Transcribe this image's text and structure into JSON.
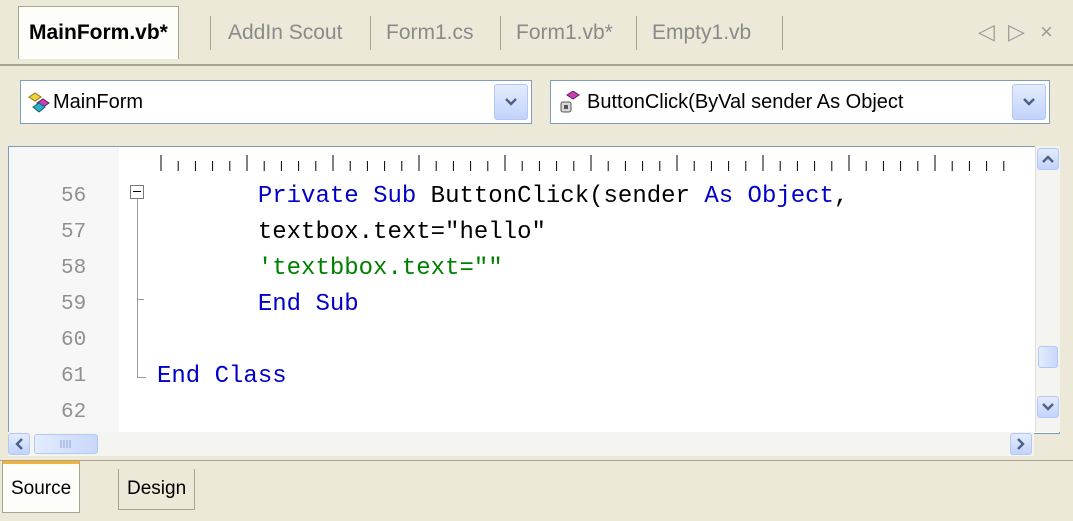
{
  "document_tabs": [
    {
      "label": "MainForm.vb*",
      "active": true
    },
    {
      "label": "AddIn Scout",
      "active": false
    },
    {
      "label": "Form1.cs",
      "active": false
    },
    {
      "label": "Form1.vb*",
      "active": false
    },
    {
      "label": "Empty1.vb",
      "active": false
    }
  ],
  "tab_nav": {
    "prev_icon": "◁",
    "next_icon": "▷",
    "close_icon": "×"
  },
  "class_combo": {
    "value": "MainForm",
    "icon": "class-icon"
  },
  "member_combo": {
    "value": "ButtonClick(ByVal sender As Object",
    "icon": "method-icon"
  },
  "editor": {
    "line_numbers": [
      "56",
      "57",
      "58",
      "59",
      "60",
      "61",
      "62"
    ],
    "lines": [
      {
        "indent": "       ",
        "parts": [
          {
            "t": "Private",
            "c": "kw"
          },
          {
            "t": " ",
            "c": ""
          },
          {
            "t": "Sub",
            "c": "kw"
          },
          {
            "t": " ButtonClick(sender ",
            "c": ""
          },
          {
            "t": "As",
            "c": "kw"
          },
          {
            "t": " ",
            "c": ""
          },
          {
            "t": "Object",
            "c": "kw"
          },
          {
            "t": ",",
            "c": ""
          }
        ]
      },
      {
        "indent": "       ",
        "parts": [
          {
            "t": "textbox.text=\"hello\"",
            "c": ""
          }
        ]
      },
      {
        "indent": "       ",
        "parts": [
          {
            "t": "'textbbox.text=\"\"",
            "c": "cm"
          }
        ]
      },
      {
        "indent": "       ",
        "parts": [
          {
            "t": "End",
            "c": "kw"
          },
          {
            "t": " ",
            "c": ""
          },
          {
            "t": "Sub",
            "c": "kw"
          }
        ]
      },
      {
        "indent": "",
        "parts": []
      },
      {
        "indent": "",
        "parts": [
          {
            "t": "End",
            "c": "kw"
          },
          {
            "t": " ",
            "c": ""
          },
          {
            "t": "Class",
            "c": "kw"
          }
        ]
      },
      {
        "indent": "",
        "parts": []
      }
    ]
  },
  "bottom_tabs": [
    {
      "label": "Source",
      "active": true
    },
    {
      "label": "Design",
      "active": false
    }
  ],
  "colors": {
    "keyword": "#0000c8",
    "comment": "#008000",
    "active_tab_accent": "#f2b33d"
  }
}
